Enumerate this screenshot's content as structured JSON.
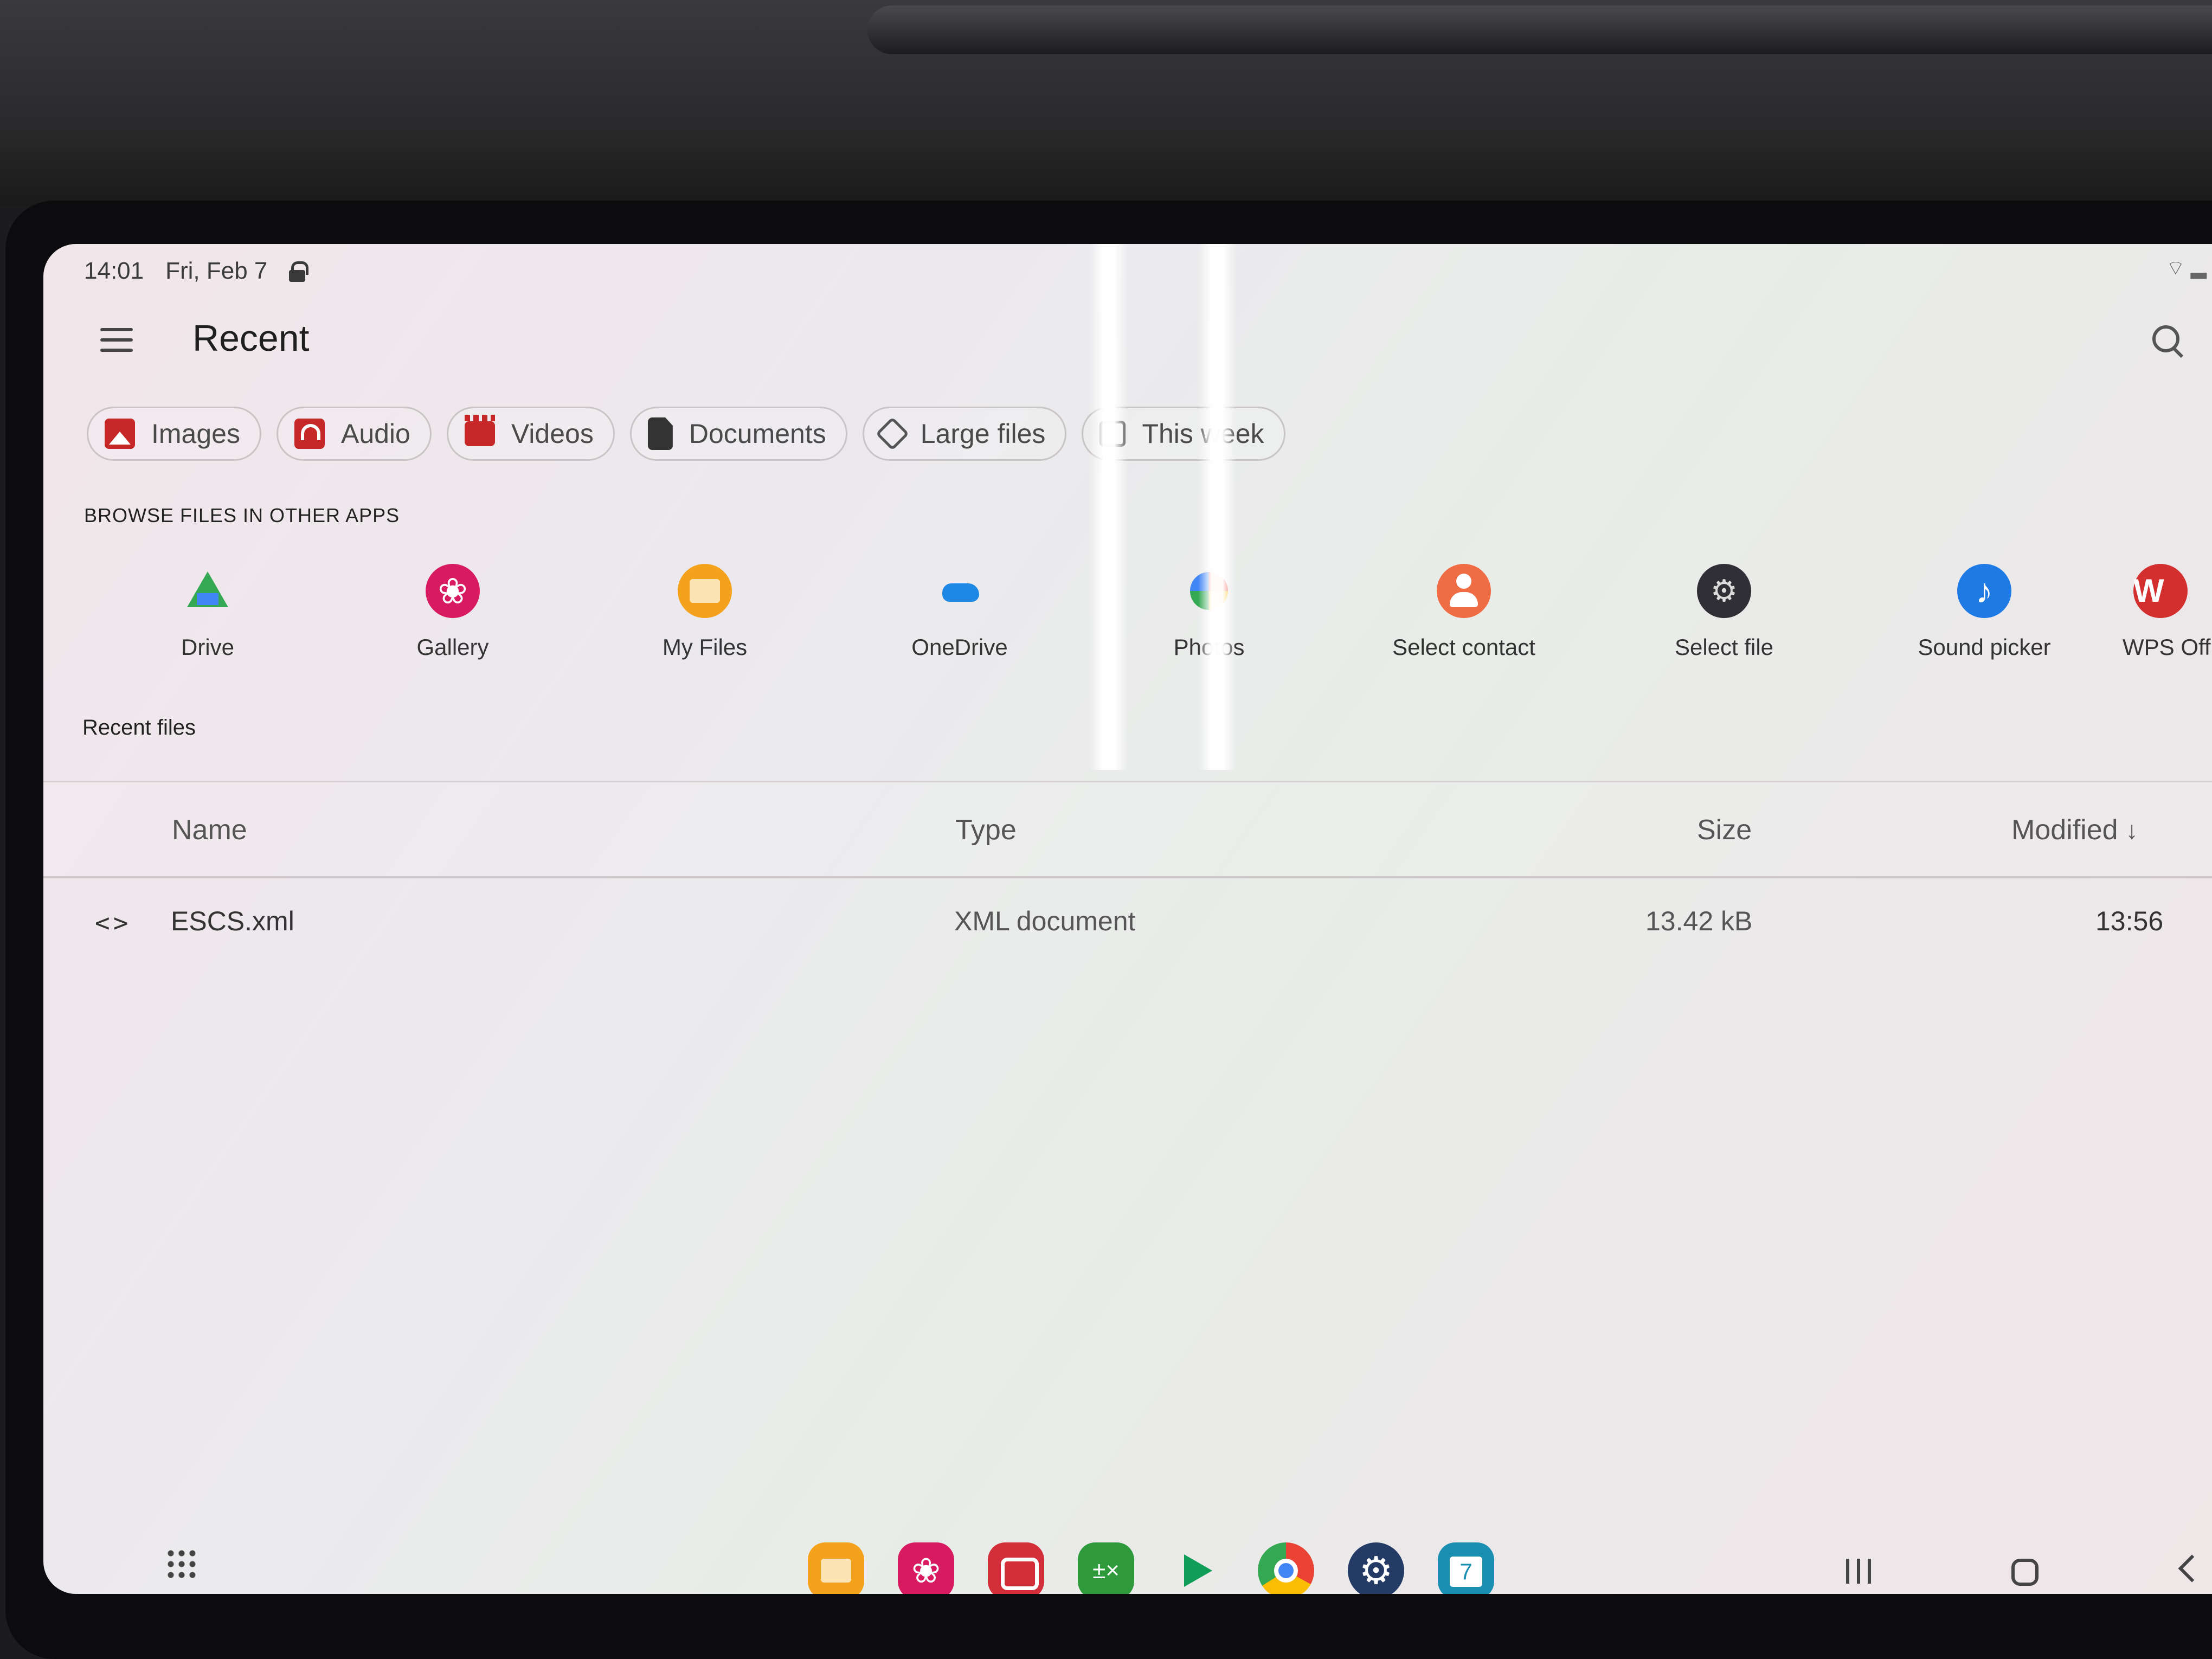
{
  "status_bar": {
    "time": "14:01",
    "date": "Fri, Feb 7"
  },
  "header": {
    "title": "Recent"
  },
  "filter_chips": [
    {
      "label": "Images",
      "icon": "image-icon"
    },
    {
      "label": "Audio",
      "icon": "headphones-icon"
    },
    {
      "label": "Videos",
      "icon": "clapperboard-icon"
    },
    {
      "label": "Documents",
      "icon": "document-icon"
    },
    {
      "label": "Large files",
      "icon": "tag-icon"
    },
    {
      "label": "This week",
      "icon": "clock-icon"
    }
  ],
  "browse_section": {
    "title": "BROWSE FILES IN OTHER APPS",
    "apps": [
      {
        "label": "Drive",
        "icon": "google-drive-icon"
      },
      {
        "label": "Gallery",
        "icon": "gallery-icon"
      },
      {
        "label": "My Files",
        "icon": "my-files-icon"
      },
      {
        "label": "OneDrive",
        "icon": "onedrive-icon"
      },
      {
        "label": "Photos",
        "icon": "google-photos-icon"
      },
      {
        "label": "Select contact",
        "icon": "contact-icon"
      },
      {
        "label": "Select file",
        "icon": "select-file-icon"
      },
      {
        "label": "Sound picker",
        "icon": "music-note-icon"
      },
      {
        "label": "WPS Office",
        "icon": "wps-office-icon"
      }
    ]
  },
  "recent_files": {
    "title": "Recent files",
    "columns": {
      "name": "Name",
      "type": "Type",
      "size": "Size",
      "modified": "Modified"
    },
    "sort": {
      "column": "modified",
      "direction": "descending"
    },
    "rows": [
      {
        "name": "ESCS.xml",
        "type": "XML document",
        "size": "13.42 kB",
        "modified": "13:56",
        "icon": "code-icon"
      }
    ]
  },
  "dock": {
    "apps": [
      {
        "name": "my-files-icon"
      },
      {
        "name": "gallery-icon"
      },
      {
        "name": "camera-icon"
      },
      {
        "name": "calculator-icon"
      },
      {
        "name": "play-store-icon"
      },
      {
        "name": "chrome-icon"
      },
      {
        "name": "settings-icon"
      },
      {
        "name": "calendar-icon"
      }
    ]
  },
  "colors": {
    "accent_red": "#c62828",
    "gallery_pink": "#d81b60",
    "files_orange": "#f4a21b",
    "text_primary": "#1f1f1f",
    "text_secondary": "#555555"
  }
}
